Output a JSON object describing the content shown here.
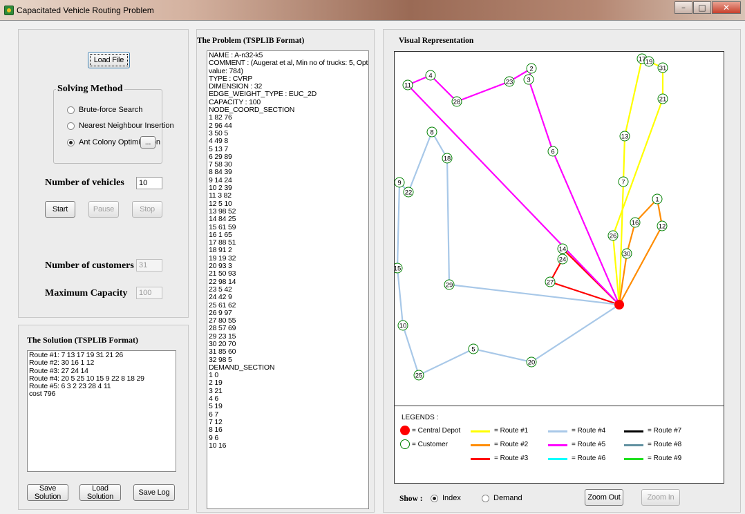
{
  "window": {
    "title": "Capacitated Vehicle Routing Problem"
  },
  "left_panel": {
    "load_file_label": "Load File",
    "solving_method": {
      "title": "Solving Method",
      "options": [
        {
          "label": "Brute-force Search",
          "checked": false
        },
        {
          "label": "Nearest Neighbour Insertion",
          "checked": false
        },
        {
          "label": "Ant Colony Optimization",
          "checked": true
        }
      ],
      "settings_label": "..."
    },
    "num_vehicles": {
      "label": "Number of vehicles",
      "value": "10"
    },
    "buttons": {
      "start": "Start",
      "pause": "Pause",
      "stop": "Stop"
    },
    "num_customers": {
      "label": "Number of customers",
      "value": "31"
    },
    "max_capacity": {
      "label": "Maximum Capacity",
      "value": "100"
    }
  },
  "solution_panel": {
    "title": "The Solution (TSPLIB Format)",
    "lines": [
      "Route #1: 7 13 17 19 31 21 26",
      "Route #2: 30 16 1 12",
      "Route #3: 27 24 14",
      "Route #4: 20 5 25 10 15 9 22 8 18 29",
      "Route #5: 6 3 2 23 28 4 11",
      "cost 796"
    ],
    "buttons": {
      "save_solution": "Save Solution",
      "load_solution": "Load Solution",
      "save_log": "Save Log"
    }
  },
  "problem_panel": {
    "title": "The Problem (TSPLIB Format)",
    "lines": [
      "NAME : A-n32-k5",
      "COMMENT : (Augerat et al, Min no of trucks: 5, Optimal",
      "value: 784)",
      "TYPE : CVRP",
      "DIMENSION : 32",
      "EDGE_WEIGHT_TYPE : EUC_2D",
      "CAPACITY : 100",
      "NODE_COORD_SECTION",
      "1 82 76",
      "2 96 44",
      "3 50 5",
      "4 49 8",
      "5 13 7",
      "6 29 89",
      "7 58 30",
      "8 84 39",
      "9 14 24",
      "10 2 39",
      "11 3 82",
      "12 5 10",
      "13 98 52",
      "14 84 25",
      "15 61 59",
      "16 1 65",
      "17 88 51",
      "18 91 2",
      "19 19 32",
      "20 93 3",
      "21 50 93",
      "22 98 14",
      "23 5 42",
      "24 42 9",
      "25 61 62",
      "26 9 97",
      "27 80 55",
      "28 57 69",
      "29 23 15",
      "30 20 70",
      "31 85 60",
      "32 98 5",
      "DEMAND_SECTION",
      "1 0",
      "2 19",
      "3 21",
      "4 6",
      "5 19",
      "6 7",
      "7 12",
      "8 16",
      "9 6",
      "10 16"
    ]
  },
  "visual": {
    "title": "Visual Representation",
    "legends_title": "LEGENDS :",
    "legend_depot": "= Central Depot",
    "legend_customer": "= Customer",
    "routes": [
      {
        "label": "= Route #1",
        "color": "#ffff00"
      },
      {
        "label": "= Route #2",
        "color": "#ff8c00"
      },
      {
        "label": "= Route #3",
        "color": "#ff0000"
      },
      {
        "label": "= Route #4",
        "color": "#a8c8e8"
      },
      {
        "label": "= Route #5",
        "color": "#ff00ff"
      },
      {
        "label": "= Route #6",
        "color": "#00ffff"
      },
      {
        "label": "= Route #7",
        "color": "#000000"
      },
      {
        "label": "= Route #8",
        "color": "#6090a0"
      },
      {
        "label": "= Route #9",
        "color": "#20e020"
      }
    ],
    "depot_color": "#ff0000",
    "customer_color": "#008000",
    "show_label": "Show :",
    "show_options": [
      {
        "label": "Index",
        "checked": true
      },
      {
        "label": "Demand",
        "checked": false
      }
    ],
    "zoom_out_label": "Zoom Out",
    "zoom_in_label": "Zoom In"
  }
}
